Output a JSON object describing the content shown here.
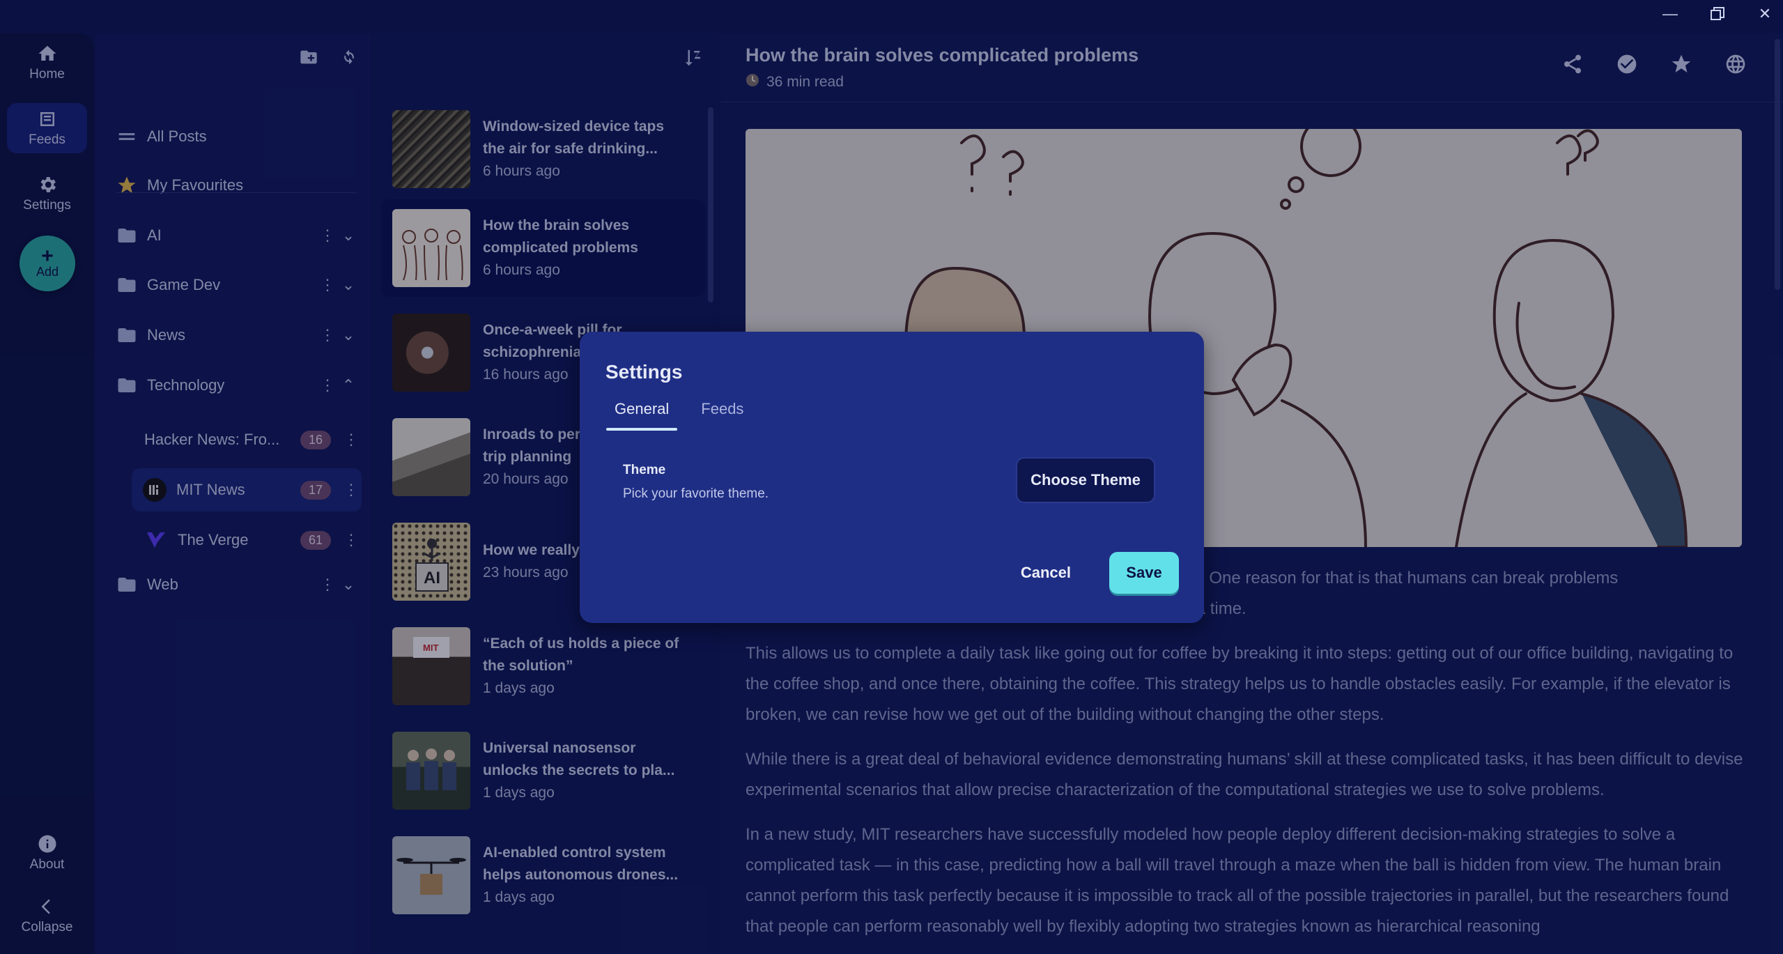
{
  "window": {
    "minimize_icon": "minimize-icon",
    "restore_icon": "restore-icon",
    "close_icon": "close-icon"
  },
  "rail": {
    "items": [
      {
        "label": "Home",
        "icon": "home-icon"
      },
      {
        "label": "Feeds",
        "icon": "feeds-icon",
        "active": true
      },
      {
        "label": "Settings",
        "icon": "gear-icon"
      }
    ],
    "add_label": "Add",
    "about_label": "About",
    "collapse_label": "Collapse"
  },
  "sidebar": {
    "all_posts": "All Posts",
    "favourites": "My Favourites",
    "folders": [
      {
        "label": "AI"
      },
      {
        "label": "Game Dev"
      },
      {
        "label": "News"
      },
      {
        "label": "Technology"
      },
      {
        "label": "Web"
      }
    ],
    "feeds": [
      {
        "label": "Hacker News: Fro...",
        "count": "16"
      },
      {
        "label": "MIT News",
        "count": "17"
      },
      {
        "label": "The Verge",
        "count": "61"
      }
    ]
  },
  "posts": [
    {
      "title": "Window-sized device taps the air for safe drinking...",
      "time": "6 hours ago"
    },
    {
      "title": "How the brain solves complicated problems",
      "time": "6 hours ago"
    },
    {
      "title": "Once-a-week pill for schizophrenia",
      "time": "16 hours ago"
    },
    {
      "title": "Inroads to personalized AI trip planning",
      "time": "20 hours ago"
    },
    {
      "title": "How we really judge AI",
      "time": "23 hours ago"
    },
    {
      "title": "“Each of us holds a piece of the solution”",
      "time": "1 days ago"
    },
    {
      "title": "Universal nanosensor unlocks the secrets to pla...",
      "time": "1 days ago"
    },
    {
      "title": "AI-enabled control system helps autonomous drones...",
      "time": "1 days ago"
    }
  ],
  "article": {
    "title": "How the brain solves complicated problems",
    "read_time": "36 min read",
    "para1_tail": "ms. One reason for that is that humans can break problems",
    "para1_tail2": "at a time.",
    "para2": "This allows us to complete a daily task like going out for coffee by breaking it into steps: getting out of our office building, navigating to the coffee shop, and once there, obtaining the coffee. This strategy helps us to handle obstacles easily. For example, if the elevator is broken, we can revise how we get out of the building without changing the other steps.",
    "para3": "While there is a great deal of behavioral evidence demonstrating humans’ skill at these complicated tasks, it has been difficult to devise experimental scenarios that allow precise characterization of the computational strategies we use to solve problems.",
    "para4": "In a new study, MIT researchers have successfully modeled how people deploy different decision-making strategies to solve a complicated task — in this case, predicting how a ball will travel through a maze when the ball is hidden from view. The human brain cannot perform this task perfectly because it is impossible to track all of the possible trajectories in parallel, but the researchers found that people can perform reasonably well by flexibly adopting two strategies known as hierarchical reasoning"
  },
  "dialog": {
    "title": "Settings",
    "tabs": [
      "General",
      "Feeds"
    ],
    "setting_label": "Theme",
    "setting_desc": "Pick your favorite theme.",
    "choose_button": "Choose Theme",
    "cancel_button": "Cancel",
    "save_button": "Save"
  }
}
